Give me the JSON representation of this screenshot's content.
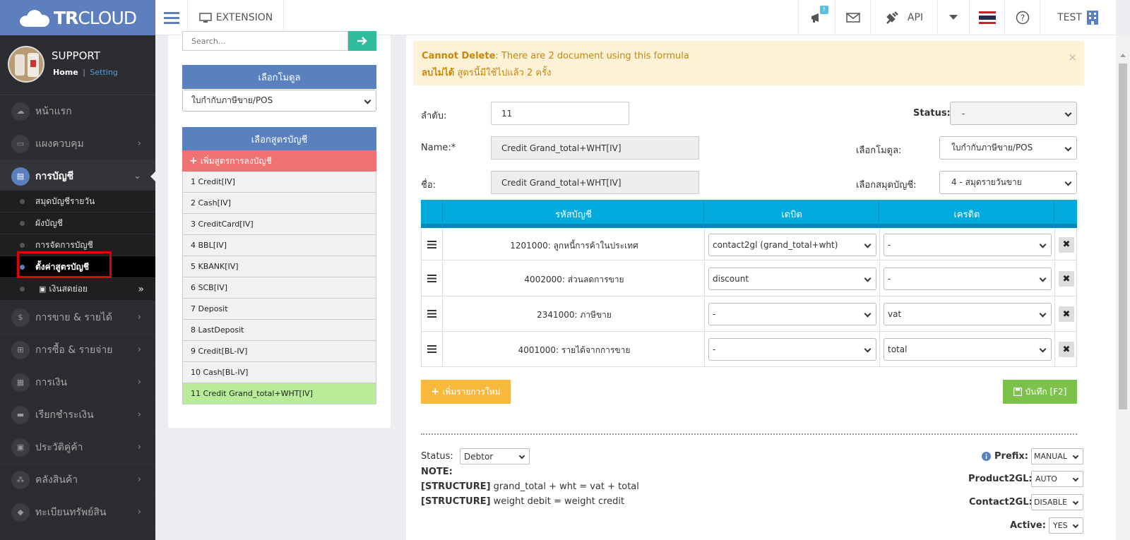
{
  "header": {
    "brand_bold": "TR",
    "brand_rest": "CLOUD",
    "extension_label": "EXTENSION",
    "notif_badge": "!",
    "api_label": "API",
    "user_label": "TEST"
  },
  "sidebar": {
    "profile_name": "SUPPORT",
    "home_link": "Home",
    "separator": "|",
    "setting_link": "Setting",
    "items": [
      {
        "label": "หน้าแรก",
        "icon": "cloud-icon"
      },
      {
        "label": "แผงควบคุม",
        "icon": "monitor-icon"
      },
      {
        "label": "การบัญชี",
        "icon": "book-icon"
      },
      {
        "label": "การขาย & รายได้",
        "icon": "dollar-icon"
      },
      {
        "label": "การซื้อ & รายจ่าย",
        "icon": "cart-icon"
      },
      {
        "label": "การเงิน",
        "icon": "calendar-icon"
      },
      {
        "label": "เรียกชำระเงิน",
        "icon": "card-icon"
      },
      {
        "label": "ประวัติคู่ค้า",
        "icon": "contact-icon"
      },
      {
        "label": "คลังสินค้า",
        "icon": "boxes-icon"
      },
      {
        "label": "ทะเบียนทรัพย์สิน",
        "icon": "diamond-icon"
      }
    ],
    "subitems": [
      {
        "label": "สมุดบัญชีรายวัน"
      },
      {
        "label": "ผังบัญชี"
      },
      {
        "label": "การจัดการบัญชี"
      },
      {
        "label": "ตั้งค่าสูตรบัญชี"
      },
      {
        "label": "เงินสดย่อย"
      }
    ]
  },
  "left_panel": {
    "search_placeholder": "Search...",
    "module_header": "เลือกโมดูล",
    "module_value": "ใบกำกับภาษีขาย/POS",
    "formula_header": "เลือกสูตรบัญชี",
    "add_formula": "เพิ่มสูตรการลงบัญชี",
    "formulas": [
      "1 Credit[IV]",
      "2 Cash[IV]",
      "3 CreditCard[IV]",
      "4 BBL[IV]",
      "5 KBANK[IV]",
      "6 SCB[IV]",
      "7 Deposit",
      "8 LastDeposit",
      "9 Credit[BL-IV]",
      "10 Cash[BL-IV]",
      "11 Credit Grand_total+WHT[IV]"
    ]
  },
  "main": {
    "alert": {
      "title_en": "Cannot Delete",
      "text_en": ": There are 2 document using this formula",
      "title_th": "ลบไม่ได้",
      "text_th": " สูตรนี้มีใช้ไปแล้ว 2 ครั้ง",
      "close": "×"
    },
    "order_label": "ลำดับ:",
    "order_value": "11",
    "status_label": "Status:",
    "status_value": "-",
    "name_label": "Name:*",
    "name_value": "Credit Grand_total+WHT[IV]",
    "module_label": "เลือกโมดูล:",
    "module_value": "ใบกำกับภาษีขาย/POS",
    "thai_name_label": "ชื่อ:",
    "thai_name_value": "Credit Grand_total+WHT[IV]",
    "journal_label": "เลือกสมุดบัญชี:",
    "journal_value": "4 - สมุดรายวันขาย",
    "table_headers": [
      "รหัสบัญชี",
      "เดบิต",
      "เครดิต"
    ],
    "rows": [
      {
        "account": "1201000: ลูกหนี้การค้าในประเทศ",
        "debit": "contact2gl (grand_total+wht)",
        "credit": "-"
      },
      {
        "account": "4002000: ส่วนลดการขาย",
        "debit": "discount",
        "credit": "-"
      },
      {
        "account": "2341000: ภาษีขาย",
        "debit": "-",
        "credit": "vat"
      },
      {
        "account": "4001000: รายได้จากการขาย",
        "debit": "-",
        "credit": "total"
      }
    ],
    "delete_glyph": "✖",
    "add_row": "เพิ่มรายการใหม่",
    "save": "บันทึก [F2]",
    "bottom": {
      "status_label": "Status:",
      "status_value": "Debtor",
      "note": "NOTE:",
      "struct1_tag": "[STRUCTURE]",
      "struct1_text": " grand_total + wht = vat + total",
      "struct2_tag": "[STRUCTURE]",
      "struct2_text": " weight debit = weight credit",
      "prefix_label": "Prefix:",
      "prefix_value": "MANUAL",
      "product2gl_label": "Product2GL:",
      "product2gl_value": "AUTO",
      "contact2gl_label": "Contact2GL:",
      "contact2gl_value": "DISABLE",
      "active_label": "Active:",
      "active_value": "YES"
    }
  },
  "colors": {
    "brand": "#5d7fbd",
    "sidebar": "#2c2d30",
    "table_header": "#00aadd",
    "add_formula": "#f07272",
    "active_formula": "#b8ec98",
    "alert_bg": "#fdf1d6",
    "add_row_btn": "#f6b93b",
    "save_btn": "#7cc14a",
    "highlight_box": "#e40000"
  }
}
